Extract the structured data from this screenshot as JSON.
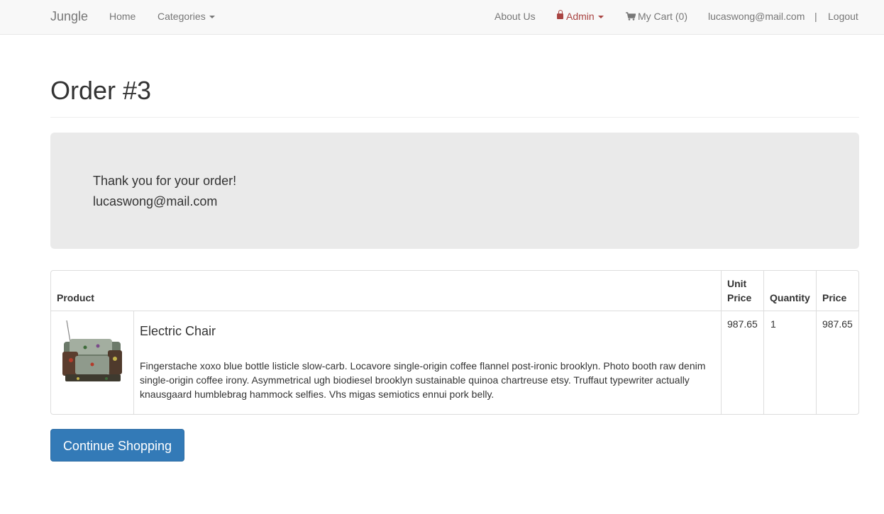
{
  "navbar": {
    "brand": "Jungle",
    "home": "Home",
    "categories": "Categories",
    "about": "About Us",
    "admin": "Admin",
    "cart": "My Cart (0)",
    "user_email": "lucaswong@mail.com",
    "separator": "|",
    "logout": "Logout"
  },
  "page": {
    "title": "Order #3"
  },
  "jumbotron": {
    "thanks": "Thank you for your order!",
    "email": "lucaswong@mail.com"
  },
  "table": {
    "headers": {
      "product": "Product",
      "unit_price_line1": "Unit",
      "unit_price_line2": "Price",
      "quantity": "Quantity",
      "price": "Price"
    },
    "rows": [
      {
        "name": "Electric Chair",
        "description": "Fingerstache xoxo blue bottle listicle slow-carb. Locavore single-origin coffee flannel post-ironic brooklyn. Photo booth raw denim single-origin coffee irony. Asymmetrical ugh biodiesel brooklyn sustainable quinoa chartreuse etsy. Truffaut typewriter actually knausgaard humblebrag hammock selfies. Vhs migas semiotics ennui pork belly.",
        "unit_price": "987.65",
        "quantity": "1",
        "price": "987.65"
      }
    ]
  },
  "actions": {
    "continue_shopping": "Continue Shopping"
  },
  "colors": {
    "primary": "#337ab7",
    "admin": "#a94442",
    "navbar_bg": "#f8f8f8",
    "jumbotron_bg": "#eaeaea"
  }
}
